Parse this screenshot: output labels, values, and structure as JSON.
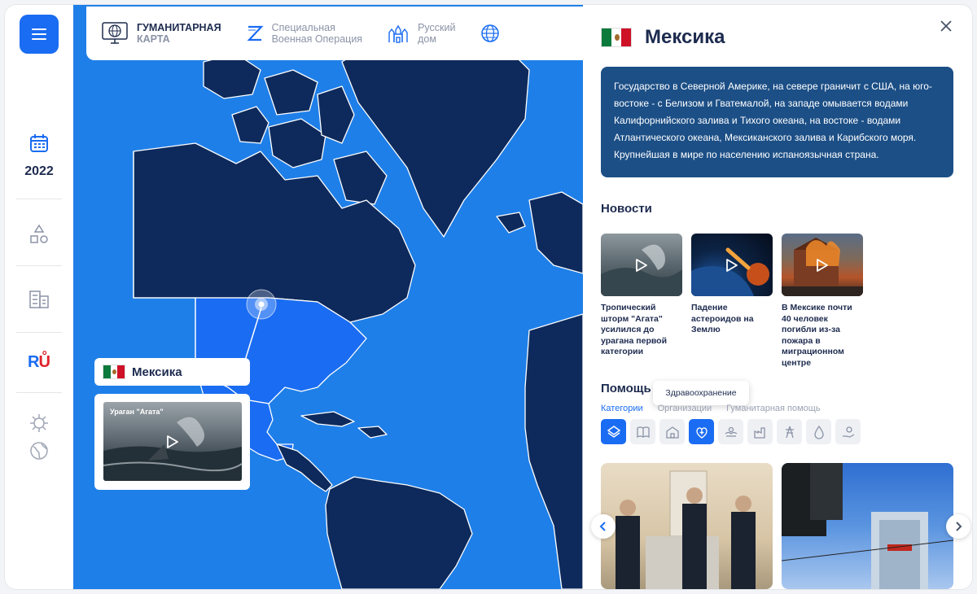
{
  "rail": {
    "year": "2022",
    "ru_logo": "RU"
  },
  "topbar": {
    "map_title_line1": "ГУМАНИТАРНАЯ",
    "map_title_line2": "КАРТА",
    "svo_line1": "Специальная",
    "svo_line2": "Военная Операция",
    "russian_house_line1": "Русский",
    "russian_house_line2": "дом"
  },
  "map": {
    "country_label": "Мексика",
    "video_caption": "Ураган \"Агата\""
  },
  "panel": {
    "country": "Мексика",
    "description": "Государство в Северной Америке, на севере граничит с США, на юго-востоке - с Белизом и Гватемалой, на западе омывается водами Калифорнийского залива и Тихого океана, на востоке - водами Атлантического океана, Мексиканского залива и Карибского моря. Крупнейшая в мире по населению испаноязычная страна.",
    "news_heading": "Новости",
    "news": [
      {
        "title": "Тропический шторм \"Агата\" усилился до урагана первой категории"
      },
      {
        "title": "Падение астероидов на Землю"
      },
      {
        "title": "В Мексике почти 40 человек погибли из-за пожара в миграционном центре"
      }
    ],
    "help_heading": "Помощь",
    "tooltip": "Здравоохранение",
    "tabs": [
      "Категории",
      "Организации",
      "Гуманитарная помощь"
    ],
    "categories": [
      "layers-icon",
      "book-icon",
      "school-icon",
      "healthcare-icon",
      "hands-icon",
      "factory-icon",
      "power-tower-icon",
      "water-drop-icon",
      "charity-hand-icon"
    ]
  },
  "colors": {
    "accent": "#1a6cf2",
    "ocean": "#1f7fe8",
    "land": "#0e2a5c",
    "desc_bg": "#1c4f86"
  }
}
